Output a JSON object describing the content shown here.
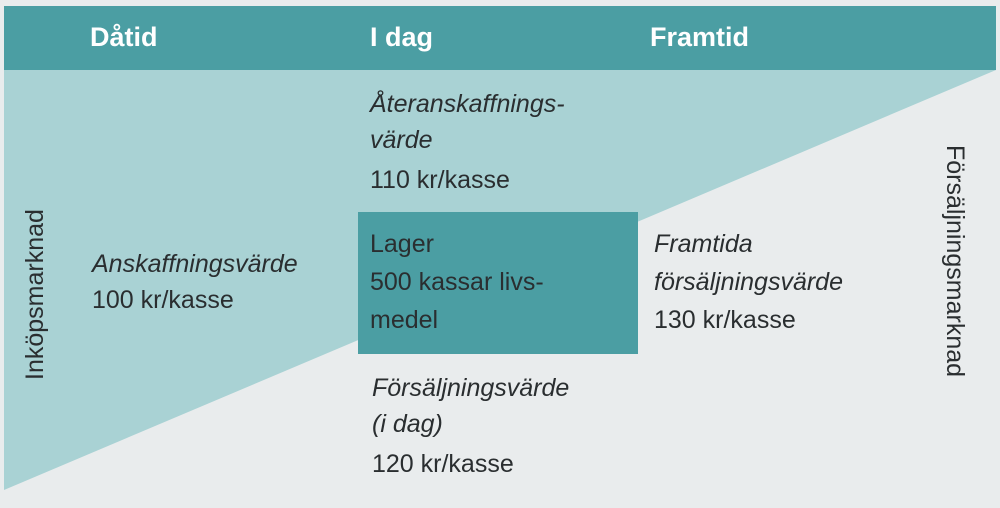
{
  "header": {
    "past": "Dåtid",
    "today": "I dag",
    "future": "Framtid"
  },
  "side_labels": {
    "left": "Inköpsmarknad",
    "right": "Försäljningsmarknad"
  },
  "replacement": {
    "line1": "Återanskaffnings-",
    "line2": "värde",
    "value": "110 kr/kasse"
  },
  "acquisition": {
    "label": "Anskaffningsvärde",
    "value": "100 kr/kasse"
  },
  "inventory": {
    "line1": "Lager",
    "line2": "500 kassar livs-",
    "line3": "medel"
  },
  "future_sales": {
    "line1": "Framtida",
    "line2": "försäljningsvärde",
    "value": "130 kr/kasse"
  },
  "current_sales": {
    "line1": "Försäljningsvärde",
    "line2": "(i dag)",
    "value": "120 kr/kasse"
  },
  "colors": {
    "header": "#4b9ea3",
    "triangle": "#a9d2d4",
    "background": "#e9eced",
    "inventory_box": "#4b9ea3"
  }
}
